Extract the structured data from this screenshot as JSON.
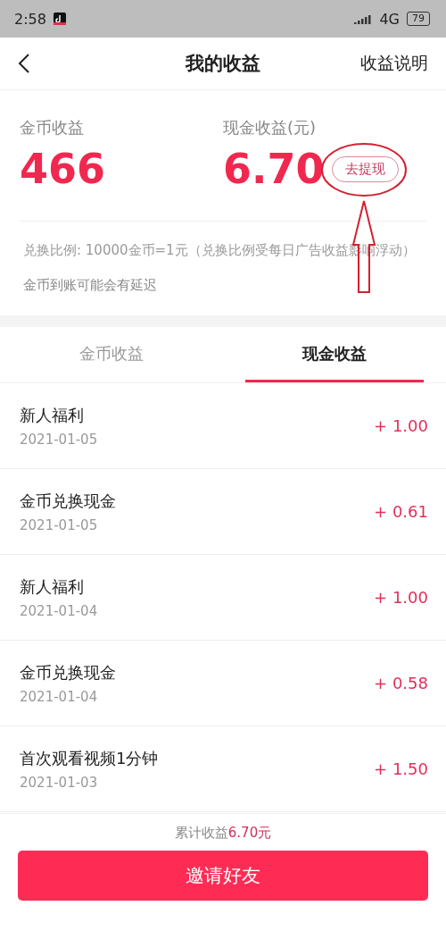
{
  "status_bar": {
    "time": "2:58",
    "network": "4G",
    "battery": "79"
  },
  "header": {
    "title": "我的收益",
    "action": "收益说明"
  },
  "summary": {
    "coins": {
      "label": "金币收益",
      "value": "466"
    },
    "cash": {
      "label": "现金收益(元)",
      "value": "6.70",
      "button": "去提现"
    },
    "notes": [
      "兑换比例: 10000金币=1元（兑换比例受每日广告收益影响浮动）",
      "金币到账可能会有延迟"
    ]
  },
  "tabs": [
    {
      "label": "金币收益",
      "selected": false
    },
    {
      "label": "现金收益",
      "selected": true
    }
  ],
  "records": [
    {
      "title": "新人福利",
      "date": "2021-01-05",
      "amount": "+ 1.00"
    },
    {
      "title": "金币兑换现金",
      "date": "2021-01-05",
      "amount": "+ 0.61"
    },
    {
      "title": "新人福利",
      "date": "2021-01-04",
      "amount": "+ 1.00"
    },
    {
      "title": "金币兑换现金",
      "date": "2021-01-04",
      "amount": "+ 0.58"
    },
    {
      "title": "首次观看视频1分钟",
      "date": "2021-01-03",
      "amount": "+ 1.50"
    }
  ],
  "footer": {
    "total": "累计收益**6.70元**",
    "button": "邀请好友"
  }
}
